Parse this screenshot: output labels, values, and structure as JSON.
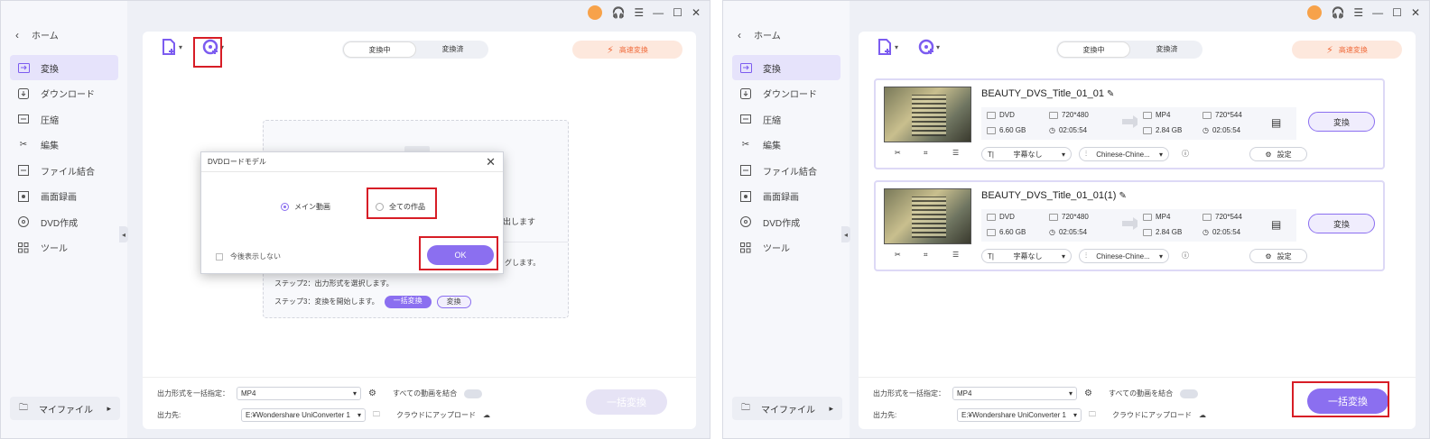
{
  "colors": {
    "accent": "#8b6ff0",
    "speed": "#f06a3a",
    "highlight": "#d71d26"
  },
  "left": {
    "sidebar": {
      "home": "ホーム",
      "items": [
        {
          "label": "変換",
          "icon": "convert-icon"
        },
        {
          "label": "ダウンロード",
          "icon": "download-icon"
        },
        {
          "label": "圧縮",
          "icon": "compress-icon"
        },
        {
          "label": "編集",
          "icon": "scissors-icon"
        },
        {
          "label": "ファイル結合",
          "icon": "merge-icon"
        },
        {
          "label": "画面録画",
          "icon": "record-icon"
        },
        {
          "label": "DVD作成",
          "icon": "dvd-icon"
        },
        {
          "label": "ツール",
          "icon": "tools-icon"
        }
      ],
      "myfile": "マイファイル"
    },
    "tabs": [
      "変換中",
      "変換済"
    ],
    "speed": "高速変換",
    "steps": {
      "step1_tail": "グします。",
      "step2": "ステップ2：出力形式を選択します。",
      "step3": "ステップ3：変換を開始します。",
      "batch_chip": "一括変換",
      "convert_chip": "変換",
      "behind_text": "出します"
    },
    "dialog": {
      "title": "DVDロードモデル",
      "option_main": "メイン動画",
      "option_all": "全ての作品",
      "dont_show": "今後表示しない",
      "ok": "OK"
    },
    "footer": {
      "format_label": "出力形式を一括指定：",
      "format_value": "MP4",
      "merge_label": "すべての動画を結合",
      "dest_label": "出力先:",
      "dest_value": "E:¥Wondershare UniConverter 1",
      "cloud_label": "クラウドにアップロード",
      "batch_button": "一括変換"
    }
  },
  "right": {
    "sidebar": {
      "home": "ホーム",
      "items": [
        {
          "label": "変換",
          "icon": "convert-icon"
        },
        {
          "label": "ダウンロード",
          "icon": "download-icon"
        },
        {
          "label": "圧縮",
          "icon": "compress-icon"
        },
        {
          "label": "編集",
          "icon": "scissors-icon"
        },
        {
          "label": "ファイル結合",
          "icon": "merge-icon"
        },
        {
          "label": "画面録画",
          "icon": "record-icon"
        },
        {
          "label": "DVD作成",
          "icon": "dvd-icon"
        },
        {
          "label": "ツール",
          "icon": "tools-icon"
        }
      ],
      "myfile": "マイファイル"
    },
    "tabs": [
      "変換中",
      "変換済"
    ],
    "speed": "高速変換",
    "cards": [
      {
        "title": "BEAUTY_DVS_Title_01_01",
        "src_format": "DVD",
        "src_res": "720*480",
        "src_size": "6.60 GB",
        "src_dur": "02:05:54",
        "dst_format": "MP4",
        "dst_res": "720*544",
        "dst_size": "2.84 GB",
        "dst_dur": "02:05:54",
        "subtitle": "字幕なし",
        "audio": "Chinese-Chine...",
        "settings": "設定",
        "convert": "変換"
      },
      {
        "title": "BEAUTY_DVS_Title_01_01(1)",
        "src_format": "DVD",
        "src_res": "720*480",
        "src_size": "6.60 GB",
        "src_dur": "02:05:54",
        "dst_format": "MP4",
        "dst_res": "720*544",
        "dst_size": "2.84 GB",
        "dst_dur": "02:05:54",
        "subtitle": "字幕なし",
        "audio": "Chinese-Chine...",
        "settings": "設定",
        "convert": "変換"
      }
    ],
    "footer": {
      "format_label": "出力形式を一括指定：",
      "format_value": "MP4",
      "merge_label": "すべての動画を結合",
      "dest_label": "出力先:",
      "dest_value": "E:¥Wondershare UniConverter 1",
      "cloud_label": "クラウドにアップロード",
      "batch_button": "一括変換"
    }
  }
}
